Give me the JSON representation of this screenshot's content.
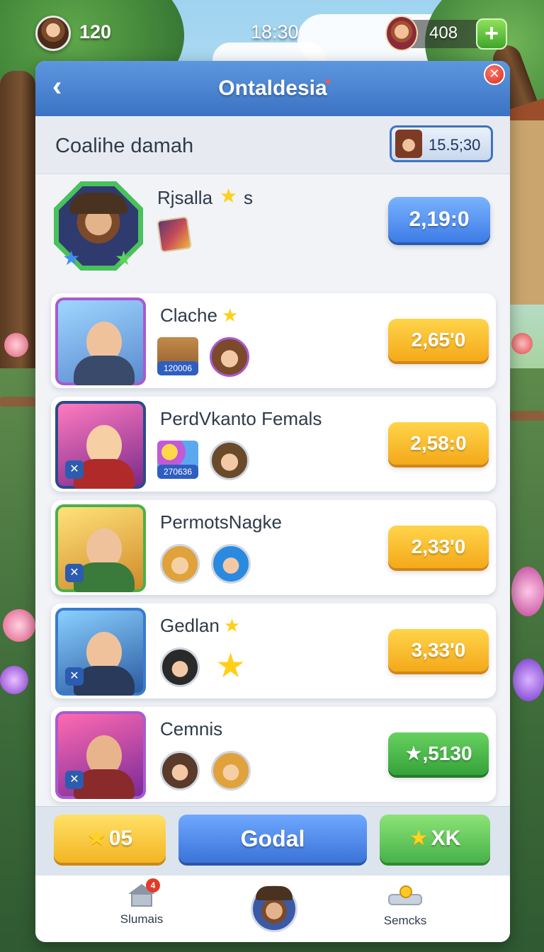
{
  "hud": {
    "level": "120",
    "clock": "18:30",
    "coins": "408",
    "add_label": "+"
  },
  "header": {
    "back_label": "‹",
    "title": "Ontaldesia",
    "close_label": "✕"
  },
  "subheader": {
    "title": "Coalihe damah",
    "timer": "15.5;30"
  },
  "featured": {
    "name": "Rjsalla",
    "suffix": "s",
    "score": "2,19:0"
  },
  "rows": [
    {
      "name": "Clache",
      "has_star": true,
      "item_tag": "120006",
      "score": "2,65'0",
      "score_color": "gold"
    },
    {
      "name": "PerdVkanto Femals",
      "has_star": false,
      "item_tag": "270636",
      "score": "2,58:0",
      "score_color": "gold"
    },
    {
      "name": "PermotsNagke",
      "has_star": false,
      "item_tag": "",
      "score": "2,33'0",
      "score_color": "gold"
    },
    {
      "name": "Gedlan",
      "has_star": true,
      "item_tag": "",
      "score": "3,33'0",
      "score_color": "gold"
    },
    {
      "name": "Cemnis",
      "has_star": false,
      "item_tag": "",
      "score": "★,5130",
      "score_color": "green"
    }
  ],
  "actions": {
    "gold_label": "05",
    "blue_label": "Godal",
    "green_label": "XK"
  },
  "nav": {
    "left_label": "Slumais",
    "left_badge": "4",
    "right_label": "Semcks"
  },
  "colors": {
    "header_blue": "#3b73c4",
    "score_gold": "#f4a91a",
    "score_green": "#35a23a",
    "score_blue": "#3d7ce6",
    "badge_red": "#e33a2a"
  }
}
